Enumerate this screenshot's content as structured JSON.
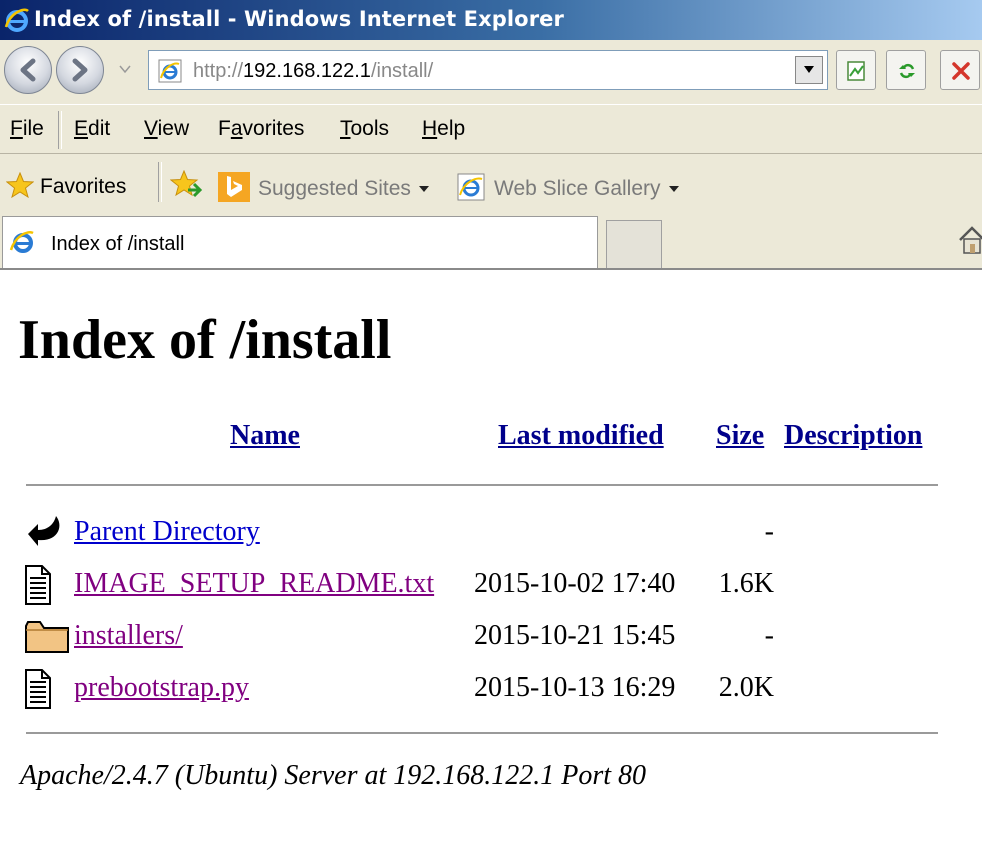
{
  "window": {
    "title": "Index of /install - Windows Internet Explorer"
  },
  "address_bar": {
    "url_prefix": "http://",
    "url_host": "192.168.122.1",
    "url_path": "/install/"
  },
  "menu": {
    "items": [
      {
        "label": "File",
        "mnemonic": "F",
        "rest": "ile"
      },
      {
        "label": "Edit",
        "mnemonic": "E",
        "rest": "dit"
      },
      {
        "label": "View",
        "mnemonic": "V",
        "rest": "iew"
      },
      {
        "label": "Favorites",
        "mnemonic_pre": "F",
        "mnemonic": "a",
        "rest": "vorites"
      },
      {
        "label": "Tools",
        "mnemonic": "T",
        "rest": "ools"
      },
      {
        "label": "Help",
        "mnemonic": "H",
        "rest": "elp"
      }
    ]
  },
  "favorites_bar": {
    "favorites_label": "Favorites",
    "suggested_sites": "Suggested Sites",
    "web_slice_gallery": "Web Slice Gallery"
  },
  "tab": {
    "label": "Index of /install"
  },
  "page": {
    "heading": "Index of /install",
    "columns": {
      "name": "Name",
      "last_modified": "Last modified",
      "size": "Size",
      "description": "Description"
    },
    "rows": [
      {
        "icon": "back-arrow-icon",
        "name": "Parent Directory",
        "date": "",
        "size": "-",
        "visited": false
      },
      {
        "icon": "text-file-icon",
        "name": "IMAGE_SETUP_README.txt",
        "date": "2015-10-02 17:40",
        "size": "1.6K",
        "visited": true
      },
      {
        "icon": "folder-icon",
        "name": "installers/",
        "date": "2015-10-21 15:45",
        "size": "-",
        "visited": true
      },
      {
        "icon": "text-file-icon",
        "name": "prebootstrap.py",
        "date": "2015-10-13 16:29",
        "size": "2.0K",
        "visited": true
      }
    ],
    "footer": "Apache/2.4.7 (Ubuntu) Server at 192.168.122.1 Port 80"
  },
  "colors": {
    "link": "#0000cc",
    "visited_link": "#800080",
    "chrome_bg": "#ece9d8"
  }
}
